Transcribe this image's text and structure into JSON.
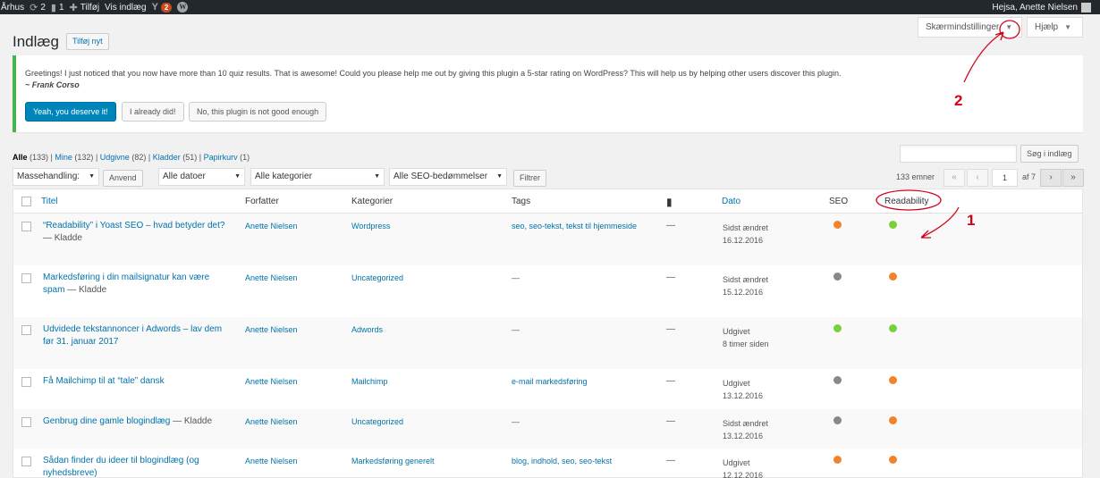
{
  "adminbar": {
    "site_name": "Århus",
    "updates_count": "2",
    "comments_count": "1",
    "new_label": "Tilføj",
    "view_label": "Vis indlæg",
    "yoast_badge": "2",
    "greeting": "Hejsa, Anette Nielsen"
  },
  "screen_options_label": "Skærmindstillinger",
  "help_label": "Hjælp",
  "page_title": "Indlæg",
  "add_new_label": "Tilføj nyt",
  "notice": {
    "message": "Greetings! I just noticed that you now have more than 10 quiz results. That is awesome! Could you please help me out by giving this plugin a 5-star rating on WordPress? This will help us by helping other users discover this plugin.",
    "signature": "~ Frank Corso",
    "btn_yes": "Yeah, you deserve it!",
    "btn_did": "I already did!",
    "btn_no": "No, this plugin is not good enough"
  },
  "subsub": [
    {
      "label": "Alle",
      "count": "(133)"
    },
    {
      "label": "Mine",
      "count": "(132)"
    },
    {
      "label": "Udgivne",
      "count": "(82)"
    },
    {
      "label": "Kladder",
      "count": "(51)"
    },
    {
      "label": "Papirkurv",
      "count": "(1)"
    }
  ],
  "search_button": "Søg i indlæg",
  "filters": {
    "bulk": "Massehandling:",
    "apply": "Anvend",
    "dates": "Alle datoer",
    "categories": "Alle kategorier",
    "seo": "Alle SEO-bedømmelser",
    "filter_btn": "Filtrer"
  },
  "pagination": {
    "count": "133 emner",
    "first": "«",
    "prev": "‹",
    "current": "1",
    "of": "af 7",
    "next": "›",
    "last": "»"
  },
  "columns": {
    "title": "Titel",
    "author": "Forfatter",
    "categories": "Kategorier",
    "tags": "Tags",
    "date": "Dato",
    "seo": "SEO",
    "readability": "Readability"
  },
  "rows": [
    {
      "title": "“Readability” i Yoast SEO – hvad betyder det?",
      "state": " — Kladde",
      "author": "Anette Nielsen",
      "category": "Wordpress",
      "tags": "seo, seo-tekst, tekst til hjemmeside",
      "comments": "—",
      "date_status": "Sidst ændret",
      "date": "16.12.2016",
      "seo": "#f0832d",
      "read": "#7ad03a"
    },
    {
      "title": "Markedsføring i din mailsignatur kan være spam",
      "state": " — Kladde",
      "author": "Anette Nielsen",
      "category": "Uncategorized",
      "tags": "—",
      "comments": "—",
      "date_status": "Sidst ændret",
      "date": "15.12.2016",
      "seo": "#888888",
      "read": "#f0832d"
    },
    {
      "title": "Udvidede tekstannoncer i Adwords – lav dem før 31. januar 2017",
      "state": "",
      "author": "Anette Nielsen",
      "category": "Adwords",
      "tags": "—",
      "comments": "—",
      "date_status": "Udgivet",
      "date": "8 timer siden",
      "seo": "#7ad03a",
      "read": "#7ad03a"
    },
    {
      "title": "Få Mailchimp til at “tale” dansk",
      "state": "",
      "author": "Anette Nielsen",
      "category": "Mailchimp",
      "tags": "e-mail markedsføring",
      "comments": "—",
      "date_status": "Udgivet",
      "date": "13.12.2016",
      "seo": "#888888",
      "read": "#f0832d"
    },
    {
      "title": "Genbrug dine gamle blogindlæg",
      "state": " — Kladde",
      "author": "Anette Nielsen",
      "category": "Uncategorized",
      "tags": "—",
      "comments": "—",
      "date_status": "Sidst ændret",
      "date": "13.12.2016",
      "seo": "#888888",
      "read": "#f0832d"
    },
    {
      "title": "Sådan finder du ideer til blogindlæg (og nyhedsbreve)",
      "state": "",
      "author": "Anette Nielsen",
      "category": "Markedsføring generelt",
      "tags": "blog, indhold, seo, seo-tekst",
      "comments": "—",
      "date_status": "Udgivet",
      "date": "12.12.2016",
      "seo": "#f0832d",
      "read": "#f0832d"
    }
  ],
  "annotations": {
    "label_1": "1",
    "label_2": "2",
    "color": "#d0021b"
  }
}
